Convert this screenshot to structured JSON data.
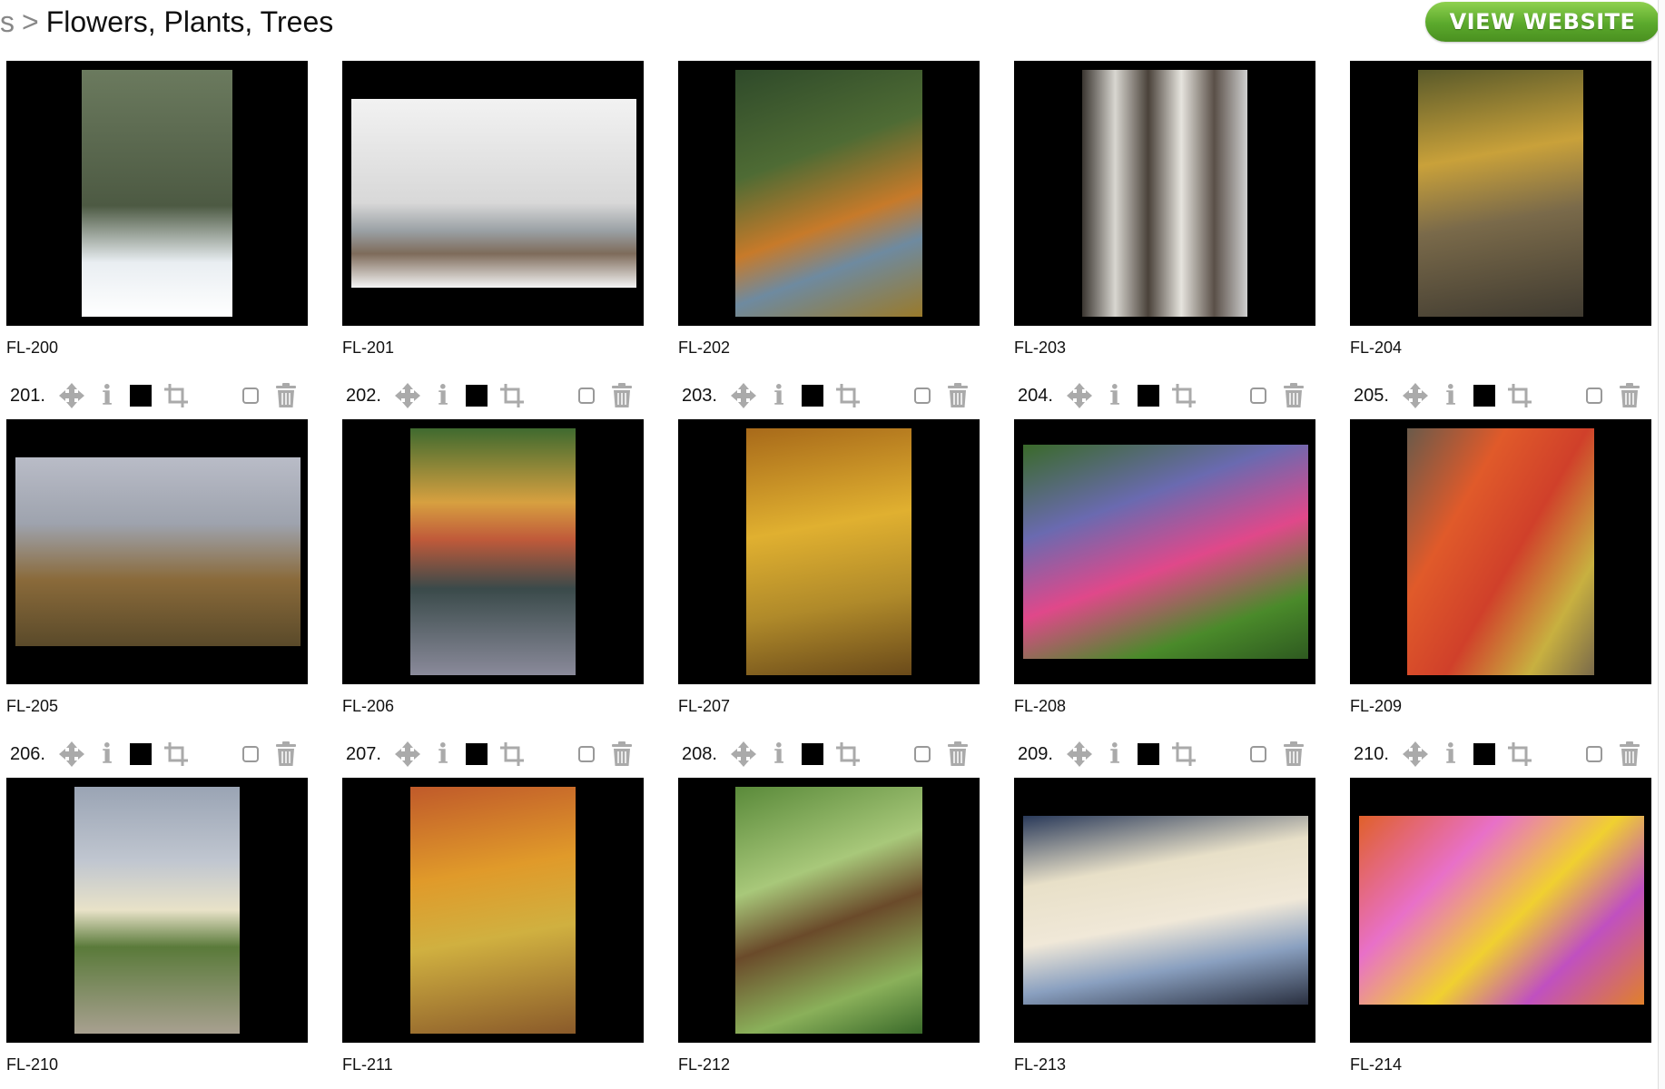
{
  "header": {
    "breadcrumb_prev": "s",
    "breadcrumb_sep": ">",
    "breadcrumb_current": "Flowers, Plants, Trees",
    "view_website_label": "VIEW WEBSITE"
  },
  "cards": [
    {
      "number": "",
      "caption": "FL-200",
      "image": "snowy-forest-bridge"
    },
    {
      "number": "",
      "caption": "FL-201",
      "image": "winter-tree-field"
    },
    {
      "number": "",
      "caption": "FL-202",
      "image": "autumn-pines-lake"
    },
    {
      "number": "",
      "caption": "FL-203",
      "image": "birch-trees-snow"
    },
    {
      "number": "",
      "caption": "FL-204",
      "image": "yellow-leaves-stream"
    },
    {
      "number": "201.",
      "caption": "FL-205",
      "image": "autumn-branches-marsh"
    },
    {
      "number": "202.",
      "caption": "FL-206",
      "image": "fall-foliage-pond"
    },
    {
      "number": "203.",
      "caption": "FL-207",
      "image": "golden-autumn-forest"
    },
    {
      "number": "204.",
      "caption": "FL-208",
      "image": "bleeding-hearts-flowers"
    },
    {
      "number": "205.",
      "caption": "FL-209",
      "image": "red-sumac-leaves"
    },
    {
      "number": "206.",
      "caption": "FL-210",
      "image": "rose-bouquet-vase"
    },
    {
      "number": "207.",
      "caption": "FL-211",
      "image": "autumn-forest-path"
    },
    {
      "number": "208.",
      "caption": "FL-212",
      "image": "pine-cones-needles"
    },
    {
      "number": "209.",
      "caption": "FL-213",
      "image": "white-roses-bouquet"
    },
    {
      "number": "210.",
      "caption": "FL-214",
      "image": "gerbera-daisies"
    }
  ],
  "icons": {
    "move": "move-arrows-icon",
    "info": "info-icon",
    "color": "black-square-icon",
    "crop": "crop-icon",
    "select": "checkbox",
    "delete": "trash-icon"
  }
}
